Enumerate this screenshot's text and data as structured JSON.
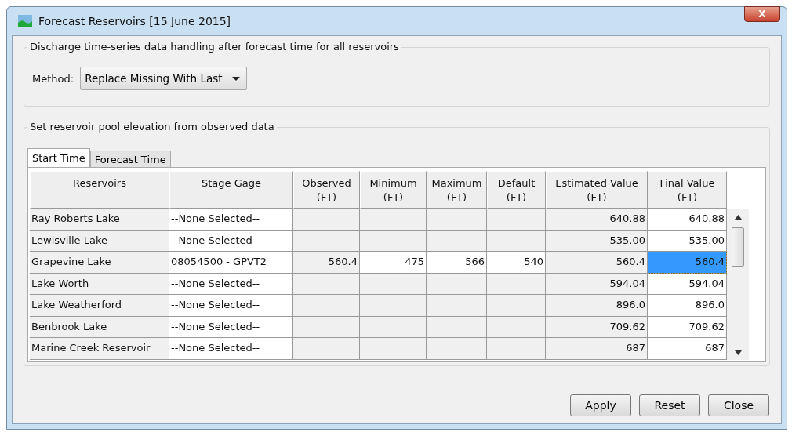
{
  "window": {
    "title": "Forecast Reservoirs [15 June 2015]",
    "close": "X"
  },
  "discharge": {
    "legend": "Discharge time-series data handling after forecast time for all reservoirs",
    "method_label": "Method:",
    "method_value": "Replace Missing With Last"
  },
  "pool": {
    "legend": "Set reservoir pool elevation from observed data",
    "tabs": [
      {
        "label": "Start Time",
        "selected": true
      },
      {
        "label": "Forecast Time",
        "selected": false
      }
    ],
    "table": {
      "columns": [
        "Reservoirs",
        "Stage Gage",
        "Observed\n(FT)",
        "Minimum\n(FT)",
        "Maximum\n(FT)",
        "Default\n(FT)",
        "Estimated Value\n(FT)",
        "Final Value\n(FT)"
      ],
      "rows": [
        {
          "reservoir": "Ray Roberts Lake",
          "stage_gage": "--None Selected--",
          "estimated": "640.88",
          "final": "640.88",
          "limits_editable": false,
          "selected": false
        },
        {
          "reservoir": "Lewisville Lake",
          "stage_gage": "--None Selected--",
          "estimated": "535.00",
          "final": "535.00",
          "limits_editable": false,
          "selected": false
        },
        {
          "reservoir": "Grapevine Lake",
          "stage_gage": "08054500 - GPVT2",
          "observed": "560.4",
          "minimum": "475",
          "maximum": "566",
          "default": "540",
          "estimated": "560.4",
          "final": "560.4",
          "limits_editable": true,
          "selected": true
        },
        {
          "reservoir": "Lake Worth",
          "stage_gage": "--None Selected--",
          "estimated": "594.04",
          "final": "594.04",
          "limits_editable": false,
          "selected": false
        },
        {
          "reservoir": "Lake Weatherford",
          "stage_gage": "--None Selected--",
          "estimated": "896.0",
          "final": "896.0",
          "limits_editable": false,
          "selected": false
        },
        {
          "reservoir": "Benbrook Lake",
          "stage_gage": "--None Selected--",
          "estimated": "709.62",
          "final": "709.62",
          "limits_editable": false,
          "selected": false
        },
        {
          "reservoir": "Marine Creek Reservoir",
          "stage_gage": "--None Selected--",
          "estimated": "687",
          "final": "687",
          "limits_editable": false,
          "selected": false
        }
      ]
    }
  },
  "buttons": [
    "Apply",
    "Reset",
    "Close"
  ]
}
